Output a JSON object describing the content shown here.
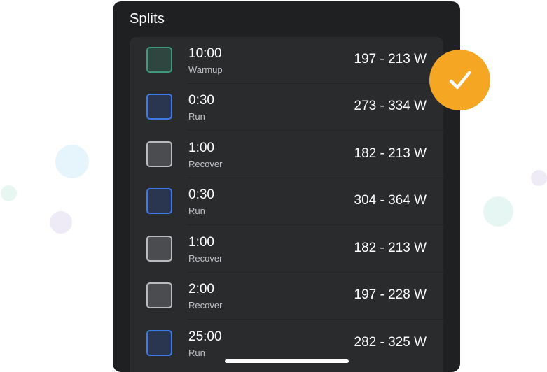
{
  "panel": {
    "title": "Splits"
  },
  "splits": [
    {
      "duration": "10:00",
      "label": "Warmup",
      "power": "197 - 213 W",
      "color": "#3f9a7b",
      "type": "green"
    },
    {
      "duration": "0:30",
      "label": "Run",
      "power": "273 - 334 W",
      "color": "#3d7ae8",
      "type": "blue"
    },
    {
      "duration": "1:00",
      "label": "Recover",
      "power": "182 - 213 W",
      "color": "#b9bbbf",
      "type": "gray"
    },
    {
      "duration": "0:30",
      "label": "Run",
      "power": "304 - 364 W",
      "color": "#3d7ae8",
      "type": "blue"
    },
    {
      "duration": "1:00",
      "label": "Recover",
      "power": "182 - 213 W",
      "color": "#b9bbbf",
      "type": "gray"
    },
    {
      "duration": "2:00",
      "label": "Recover",
      "power": "197 - 228 W",
      "color": "#b9bbbf",
      "type": "gray"
    },
    {
      "duration": "25:00",
      "label": "Run",
      "power": "282 - 325 W",
      "color": "#3d7ae8",
      "type": "blue"
    }
  ],
  "badge": {
    "icon": "checkmark-icon",
    "color": "#f5a623"
  }
}
